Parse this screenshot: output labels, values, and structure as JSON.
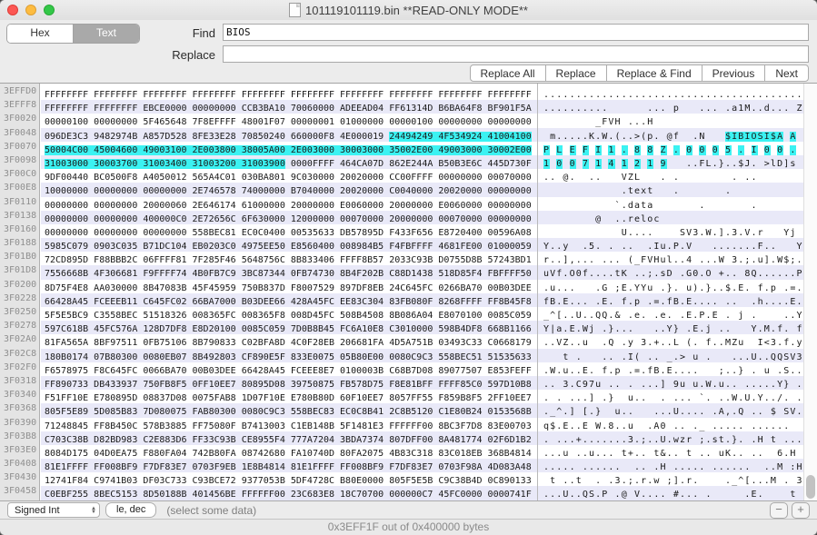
{
  "window": {
    "title": "101119101119.bin **READ-ONLY MODE**",
    "traffic_lights": {
      "close": "#FC5753",
      "minimize": "#FDBC40",
      "maximize": "#33C748"
    }
  },
  "find_bar": {
    "mode_segments": [
      "Hex",
      "Text"
    ],
    "selected_segment": "Text",
    "find_label": "Find",
    "find_value": "BIOS",
    "replace_label": "Replace",
    "replace_value": "",
    "buttons": [
      "Replace All",
      "Replace",
      "Replace & Find",
      "Previous",
      "Next"
    ]
  },
  "hex_view": {
    "bytes_per_row": 40,
    "group_bytes": 4,
    "selection": {
      "start_index": 148,
      "end_index": 220,
      "color": "#3BF2F2"
    },
    "row_stripe_color": "#E9E9F8",
    "rows": [
      {
        "offset": "3EFFD0",
        "hex": "FFFFFFFF FFFFFFFF FFFFFFFF FFFFFFFF FFFFFFFF FFFFFFFF FFFFFFFF FFFFFFFF FFFFFFFF FFFFFFFF",
        "ascii": "........................................"
      },
      {
        "offset": "3EFFF8",
        "hex": "FFFFFFFF FFFFFFFF EBCE0000 00000000 CCB3BA10 70060000 ADEEAD04 FF61314D B6BA64F8 BF901F5A",
        "ascii": "..........      ... p   ... .a1M..d... Z"
      },
      {
        "offset": "3F0020",
        "hex": "00000100 00000000 5F465648 7F8EFFFF 48001F07 00000001 01000000 00000100 00000000 00000000",
        "ascii": "        _FVH ...H                       "
      },
      {
        "offset": "3F0048",
        "hex": "096DE3C3 9482974B A857D528 8FE33E28 70850240 660000F8 4E000019 24494249 4F534924 41004100",
        "ascii": " m.....K.W.(..>(p. @f  .N   $IBIOSI$A A "
      },
      {
        "offset": "3F0070",
        "hex": "50004C00 45004600 49003100 2E003800 38005A00 2E003000 30003000 35002E00 49003000 30002E00",
        "ascii": "P L E F I 1 . 8 8 Z . 0 0 0 5 . I 0 0 . "
      },
      {
        "offset": "3F0098",
        "hex": "31003000 30003700 31003400 31003200 31003900 0000FFFF 464CA07D 862E244A B50B3E6C 445D730F",
        "ascii": "1 0 0 7 1 4 1 2 1 9   ..FL.}..$J. >lD]s "
      },
      {
        "offset": "3F00C0",
        "hex": "9DF00440 BC0500F8 A4050012 565A4C01 030BA801 9C030000 20020000 CC00FFFF 00000000 00070000",
        "ascii": ".. @.  ..   VZL   . .        . ..       "
      },
      {
        "offset": "3F00E8",
        "hex": "10000000 00000000 00000000 2E746578 74000000 B7040000 20020000 C0040000 20020000 00000000",
        "ascii": "            .text   .       .           "
      },
      {
        "offset": "3F0110",
        "hex": "00000000 00000000 20000060 2E646174 61000000 20000000 E0060000 20000000 E0060000 00000000",
        "ascii": "           `.data       .       .       "
      },
      {
        "offset": "3F0138",
        "hex": "00000000 00000000 400000C0 2E72656C 6F630000 12000000 00070000 20000000 00070000 00000000",
        "ascii": "        @  ..reloc                      "
      },
      {
        "offset": "3F0160",
        "hex": "00000000 00000000 00000000 558BEC81 EC0C0400 00535633 DB57895D F433F656 E8720400 00596A08",
        "ascii": "            U....    SV3.W.].3.V.r   Yj "
      },
      {
        "offset": "3F0188",
        "hex": "5985C079 0903C035 B71DC104 EB0203C0 4975EE50 E8560400 008984B5 F4FBFFFF 4681FE00 01000059",
        "ascii": "Y..y  .5. . ..  .Iu.P.V   .......F..   Y"
      },
      {
        "offset": "3F01B0",
        "hex": "72CD895D F88BBB2C 06FFFF81 7F285F46 5648756C 8B833406 FFFF8B57 2033C93B D0755D8B 57243BD1",
        "ascii": "r..],... ... (_FVHul..4 ...W 3.;.u].W$;."
      },
      {
        "offset": "3F01D8",
        "hex": "7556668B 4F306681 F9FFFF74 4B0FB7C9 3BC87344 0FB74730 8B4F202B C88D1438 518D85F4 FBFFFF50",
        "ascii": "uVf.O0f....tK ..;.sD .G0.O +.. 8Q......P"
      },
      {
        "offset": "3F0200",
        "hex": "8D75F4E8 AA030000 8B47083B 45F45959 750B837D F8007529 897DF8EB 24C645FC 0266BA70 00B03DEE",
        "ascii": ".u...   .G ;E.YYu .}. u).}..$.E. f.p .=."
      },
      {
        "offset": "3F0228",
        "hex": "66428A45 FCEEEB11 C645FC02 66BA7000 B03DEE66 428A45FC EE83C304 83FB080F 8268FFFF FF8B45F8",
        "ascii": "fB.E... .E. f.p .=.fB.E.... ..  .h....E."
      },
      {
        "offset": "3F0250",
        "hex": "5F5E5BC9 C3558BEC 51518326 008365FC 008365F8 008D45FC 508B4508 8B086A04 E8070100 0085C059",
        "ascii": "_^[..U..QQ.& .e. .e. .E.P.E . j .    ..Y"
      },
      {
        "offset": "3F0278",
        "hex": "597C618B 45FC576A 128D7DF8 E8D20100 0085C059 7D0B8B45 FC6A10E8 C3010000 598B4DF8 668B1166",
        "ascii": "Y|a.E.Wj .}...   ..Y} .E.j ..   Y.M.f. f"
      },
      {
        "offset": "3F02A0",
        "hex": "81FA565A 8BF97511 0FB75106 8B790833 C02BFA8D 4C0F28EB 206681FA 4D5A751B 03493C33 C0668179",
        "ascii": "..VZ..u  .Q .y 3.+..L (. f..MZu  I<3.f.y"
      },
      {
        "offset": "3F02C8",
        "hex": "180B0174 07B80300 0080EB07 8B492803 CF890E5F 833E0075 05B80E00 0080C9C3 558BEC51 51535633",
        "ascii": "   t .   .. .I( .. _.> u .   ...U..QQSV3"
      },
      {
        "offset": "3F02F0",
        "hex": "F6578975 F8C645FC 0066BA70 00B03DEE 66428A45 FCEEE8E7 0100003B C68B7D08 89077507 E853FEFF",
        "ascii": ".W.u..E. f.p .=.fB.E....   ;..} . u .S.."
      },
      {
        "offset": "3F0318",
        "hex": "FF890733 DB433937 750FB8F5 0FF10EE7 80895D08 39750875 FB578D75 F8E81BFF FFFF85C0 597D10B8",
        "ascii": ".. 3.C97u .. . ...] 9u u.W.u.. .....Y} ."
      },
      {
        "offset": "3F0340",
        "hex": "F51FF10E E780895D 08837D08 0075FAB8 1D07F10E E780B80D 60F10EE7 8057FF55 F859B8F5 2FF10EE7",
        "ascii": ". . ...] .}  u..  . ... `. ..W.U.Y../. ."
      },
      {
        "offset": "3F0368",
        "hex": "805F5E89 5D085B83 7D080075 FAB80300 0080C9C3 558BEC83 EC0C8B41 2C8B5120 C1E80B24 0153568B",
        "ascii": "._^.] [.}  u..   ...U.... .A,.Q .. $ SV."
      },
      {
        "offset": "3F0390",
        "hex": "71248845 FF8B450C 578B3885 FF75080F B7413003 C1EB148B 5F1481E3 FFFFFF00 8BC3F7D8 83E00703",
        "ascii": "q$.E..E W.8..u  .A0 .. ._ ..... ......  "
      },
      {
        "offset": "3F03B8",
        "hex": "C703C38B D82BD983 C2E883D6 FF33C93B CE8955F4 777A7204 3BDA7374 807DFF00 8A481774 02F6D1B2",
        "ascii": ". ...+.......3.;..U.wzr ;.st.}. .H t ..."
      },
      {
        "offset": "3F03E0",
        "hex": "8084D175 04D0EA75 F880FA04 742B80FA 08742680 FA10740D 80FA2075 4B83C318 83C018EB 368B4814",
        "ascii": "...u ..u... t+.. t&.. t .. uK.. ..  6.H "
      },
      {
        "offset": "3F0408",
        "hex": "81E1FFFF FF008BF9 F7DF83E7 0703F9EB 1E8B4814 81E1FFFF FF008BF9 F7DF83E7 0703F98A 4D083A48",
        "ascii": "..... ......  .. .H ..... ......  ..M :H"
      },
      {
        "offset": "3F0430",
        "hex": "12741F84 C9741B03 DF03C733 C93BCE72 9377053B 5DF4728C B80E0000 805F5E5B C9C38B4D 0C890133",
        "ascii": " t ..t  . .3.;.r.w ;].r.    ._^[...M . 3"
      },
      {
        "offset": "3F0458",
        "hex": "C0EBF255 8BEC5153 8D50188B 401456BE FFFFFF00 23C683E8 18C70700 000000C7 45FC0000 0000741F",
        "ascii": "...U..QS.P .@ V.... #... .     .E.    t "
      }
    ]
  },
  "bottom_bar": {
    "type_select": "Signed Int",
    "endianness": "le, dec",
    "hint": "(select some data)",
    "zoom_out": "−",
    "zoom_in": "+"
  },
  "status_bar": {
    "text": "0x3EFF1F out of 0x400000 bytes"
  }
}
